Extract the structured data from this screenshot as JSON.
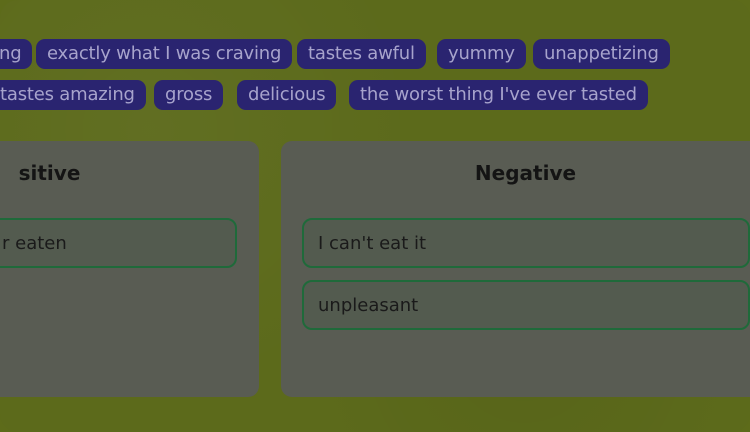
{
  "chips_row1": [
    "ng",
    "exactly what I was craving",
    "tastes awful",
    "yummy",
    "unappetizing"
  ],
  "chips_row2": [
    "tastes amazing",
    "gross",
    "delicious",
    "the worst thing I've ever tasted"
  ],
  "positive": {
    "title": "sitive",
    "items": [
      "r eaten"
    ]
  },
  "negative": {
    "title": "Negative",
    "items": [
      "I can't eat it",
      "unpleasant"
    ]
  }
}
